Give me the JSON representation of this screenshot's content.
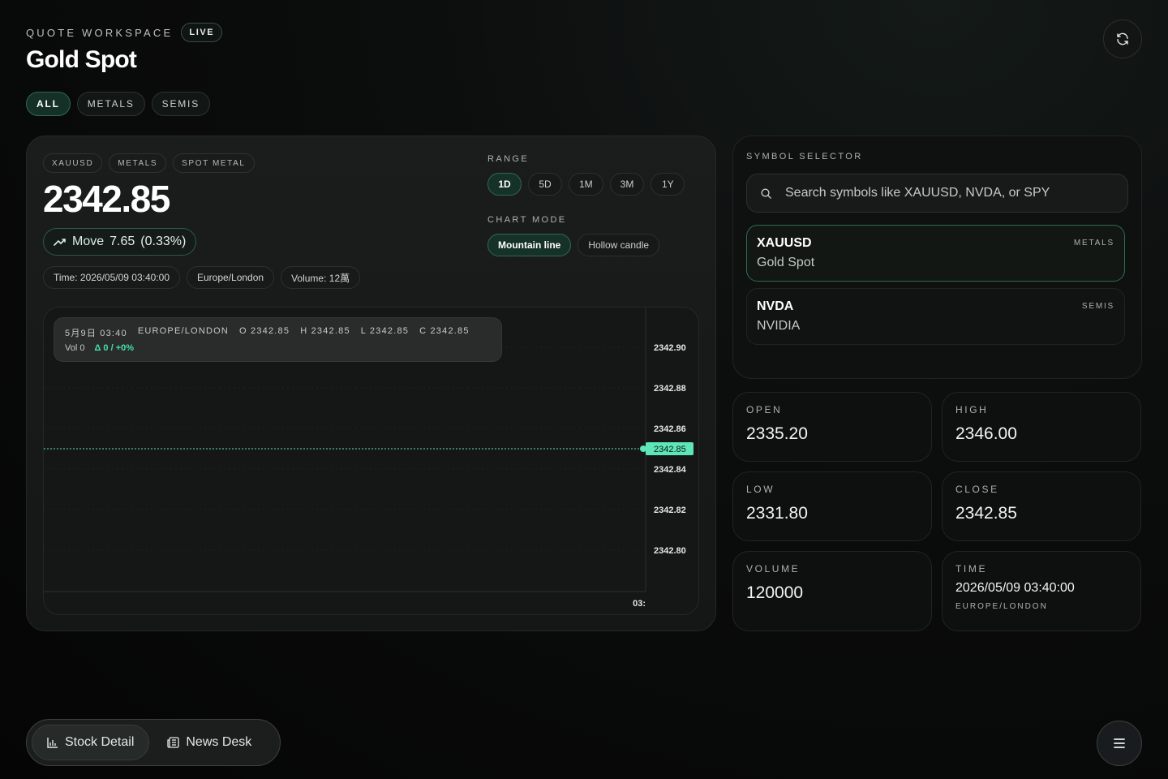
{
  "header": {
    "eyebrow": "QUOTE WORKSPACE",
    "live_badge": "LIVE",
    "title": "Gold Spot"
  },
  "filters": [
    {
      "label": "ALL",
      "active": true
    },
    {
      "label": "METALS",
      "active": false
    },
    {
      "label": "SEMIS",
      "active": false
    }
  ],
  "quote": {
    "tags": [
      "XAUUSD",
      "METALS",
      "SPOT METAL"
    ],
    "price": "2342.85",
    "move_label": "Move",
    "move_value": "7.65",
    "move_pct": "(0.33%)",
    "time": "Time: 2026/05/09 03:40:00",
    "timezone": "Europe/London",
    "volume": "Volume: 12萬"
  },
  "range": {
    "label": "RANGE",
    "options": [
      "1D",
      "5D",
      "1M",
      "3M",
      "1Y"
    ],
    "selected": "1D"
  },
  "chart_mode": {
    "label": "CHART MODE",
    "options": [
      "Mountain line",
      "Hollow candle"
    ],
    "selected": "Mountain line"
  },
  "ohlc": {
    "date": "5月9日 03:40",
    "zone": "EUROPE/LONDON",
    "open": "O 2342.85",
    "high": "H 2342.85",
    "low": "L 2342.85",
    "close": "C 2342.85",
    "vol": "Vol 0",
    "delta": "Δ 0 / +0%"
  },
  "chart_data": {
    "type": "line",
    "x": [
      "03:40"
    ],
    "series": [
      {
        "values": [
          2342.85
        ]
      }
    ],
    "y_ticks": [
      "2342.90",
      "2342.88",
      "2342.86",
      "2342.84",
      "2342.82",
      "2342.80"
    ],
    "x_tick_label": "03:",
    "ylim": [
      2342.8,
      2342.9
    ],
    "last_price_label": "2342.85",
    "accent": "#5ee6b8"
  },
  "selector": {
    "title": "SYMBOL SELECTOR",
    "placeholder": "Search symbols like XAUUSD, NVDA, or SPY",
    "items": [
      {
        "ticker": "XAUUSD",
        "name": "Gold Spot",
        "group": "METALS",
        "selected": true
      },
      {
        "ticker": "NVDA",
        "name": "NVIDIA",
        "group": "SEMIS",
        "selected": false
      }
    ]
  },
  "stats": {
    "open": {
      "label": "OPEN",
      "value": "2335.20"
    },
    "high": {
      "label": "HIGH",
      "value": "2346.00"
    },
    "low": {
      "label": "LOW",
      "value": "2331.80"
    },
    "close": {
      "label": "CLOSE",
      "value": "2342.85"
    },
    "volume": {
      "label": "VOLUME",
      "value": "120000"
    },
    "time": {
      "label": "TIME",
      "value": "2026/05/09 03:40:00",
      "sub": "EUROPE/LONDON"
    }
  },
  "bottom_nav": {
    "stock_detail": "Stock Detail",
    "news_desk": "News Desk"
  },
  "colors": {
    "accent": "#5ee6b8",
    "active_chip": "#153026"
  }
}
